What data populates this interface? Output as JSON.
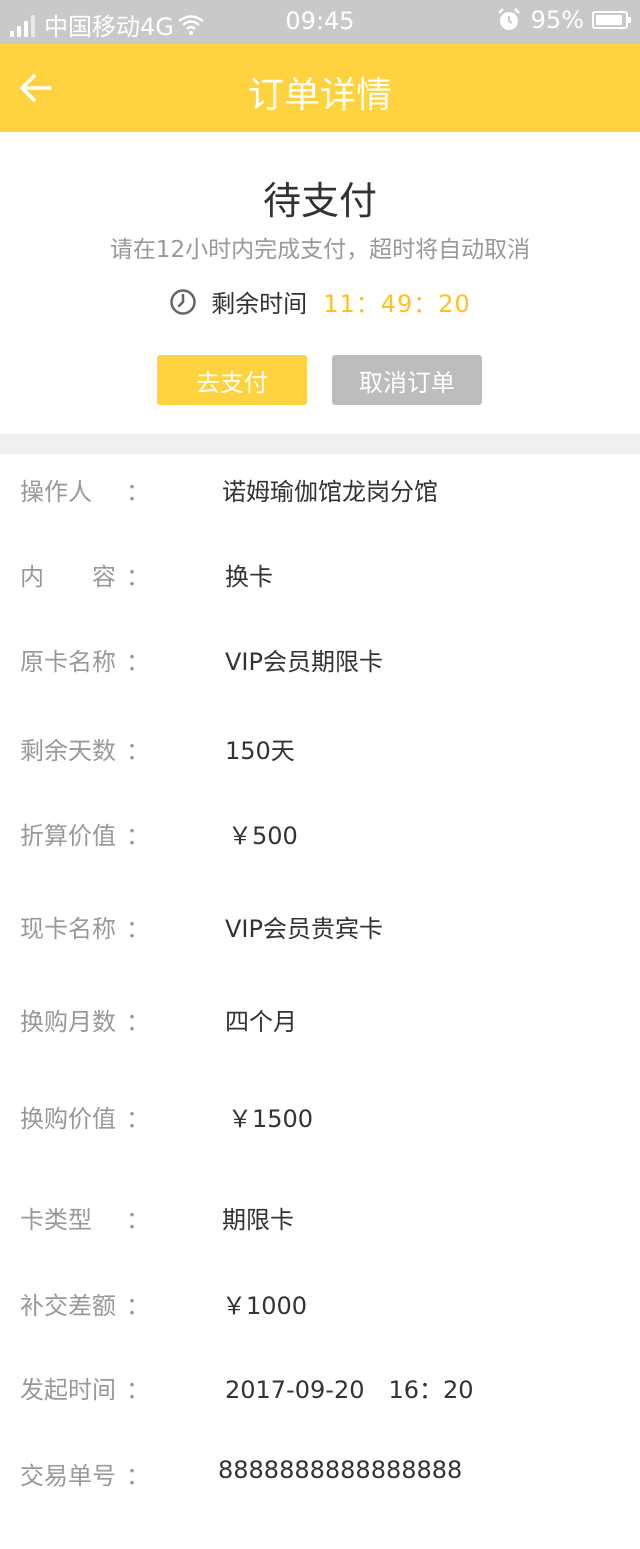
{
  "status_bar": {
    "carrier": "中国移动4G",
    "time": "09:45",
    "battery": "95%"
  },
  "header": {
    "title": "订单详情"
  },
  "order_status": {
    "title": "待支付",
    "subtitle": "请在12小时内完成支付，超时将自动取消",
    "countdown_label": "剩余时间",
    "countdown_value": "11：49：20",
    "pay_button": "去支付",
    "cancel_button": "取消订单"
  },
  "details": [
    {
      "label": "操作人",
      "colon": "：",
      "value": "诺姆瑜伽馆龙岗分馆"
    },
    {
      "label": "内　　容",
      "colon": "：",
      "value": "换卡"
    },
    {
      "label": "原卡名称",
      "colon": "：",
      "value": "VIP会员期限卡"
    },
    {
      "label": "剩余天数",
      "colon": "：",
      "value": "150天"
    },
    {
      "label": "折算价值",
      "colon": "：",
      "value": "￥500"
    },
    {
      "label": "现卡名称",
      "colon": "：",
      "value": "VIP会员贵宾卡"
    },
    {
      "label": "换购月数",
      "colon": "：",
      "value": "四个月"
    },
    {
      "label": "换购价值",
      "colon": "：",
      "value": "￥1500"
    },
    {
      "label": "卡类型",
      "colon": "：",
      "value": "期限卡"
    },
    {
      "label": "补交差额",
      "colon": "：",
      "value": "￥1000"
    },
    {
      "label": "发起时间",
      "colon": "：",
      "value": "2017-09-20　16：20"
    },
    {
      "label": "交易单号",
      "colon": "：",
      "value": "8888888888888888"
    }
  ],
  "colors": {
    "accent": "#ffd23f",
    "countdown": "#ffc11f",
    "cancel_button": "#bdbdbd"
  },
  "icons": [
    "back-arrow-icon",
    "clock-icon",
    "signal-icon",
    "wifi-icon",
    "alarm-icon",
    "battery-icon"
  ]
}
